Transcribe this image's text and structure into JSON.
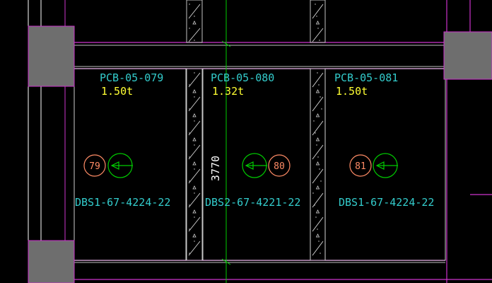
{
  "colors": {
    "background": "#000000",
    "beam_magenta": "#cc33cc",
    "panel_outline": "#ffffff",
    "column_fill": "#6e6e6e",
    "wall_hatch": "#d8d8d8",
    "dimension_green": "#00cc00",
    "label_cyan": "#33cccc",
    "weight_yellow": "#ffff33",
    "tag_orange": "#ff8c66"
  },
  "panels": [
    {
      "code": "PCB-05-079",
      "weight": "1.50t",
      "number": "79",
      "designation": "DBS1-67-4224-22",
      "arrow_icon": "direction-arrow-left-icon"
    },
    {
      "code": "PCB-05-080",
      "weight": "1.32t",
      "number": "80",
      "designation": "DBS2-67-4221-22",
      "arrow_icon": "direction-arrow-left-icon"
    },
    {
      "code": "PCB-05-081",
      "weight": "1.50t",
      "number": "81",
      "designation": "DBS1-67-4224-22",
      "arrow_icon": "direction-arrow-left-icon"
    }
  ],
  "dimension": {
    "value": "3770"
  }
}
